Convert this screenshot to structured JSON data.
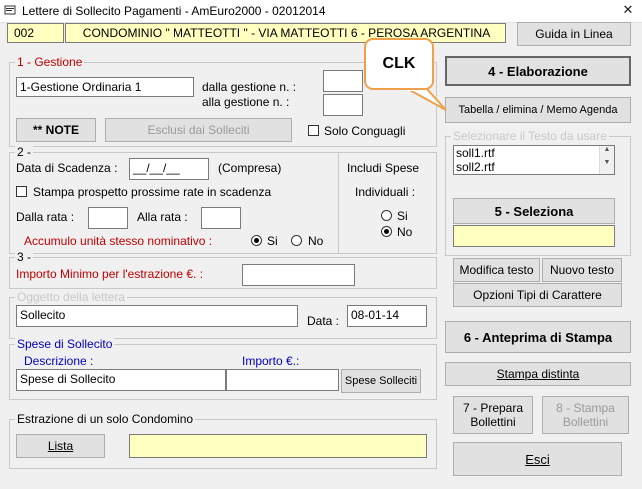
{
  "window": {
    "title": "Lettere di Sollecito Pagamenti - AmEuro2000 - 02012014",
    "close_glyph": "✕"
  },
  "header": {
    "code": "002",
    "condo_name": "CONDOMINIO \" MATTEOTTI \" - VIA MATTEOTTI 6 - PEROSA ARGENTINA",
    "help_button": "Guida in Linea"
  },
  "gestione": {
    "group_label": "1 - Gestione",
    "value": "1-Gestione Ordinaria 1",
    "dalla_label": "dalla gestione n. :",
    "alla_label": "alla gestione n. :",
    "dalla_value": "",
    "alla_value": "",
    "note_button": "** NOTE",
    "esclusi_button": "Esclusi dai Solleciti",
    "solo_conguagli_label": "Solo Conguagli"
  },
  "section2": {
    "group_label": "2 -",
    "data_scadenza_label": "Data di Scadenza :",
    "data_scadenza_value": "__/__/__",
    "compresa_label": "(Compresa)",
    "stampa_prospetto_label": "Stampa prospetto prossime rate in scadenza",
    "dalla_rata_label": "Dalla rata :",
    "alla_rata_label": "Alla rata :",
    "accumulo_label": "Accumulo unità stesso nominativo :",
    "si_label": "Si",
    "no_label": "No",
    "includi_label": "Includi Spese",
    "individuali_label": "Individuali :",
    "indiv_si": "Si",
    "indiv_no": "No"
  },
  "section3": {
    "group_label": "3 -",
    "importo_minimo_label": "Importo Minimo per l'estrazione €. :",
    "oggetto_label": "Oggetto della lettera",
    "oggetto_value": "Sollecito",
    "data_label": "Data :",
    "data_value": "08-01-14"
  },
  "spese": {
    "group_label": "Spese di Sollecito",
    "descrizione_label": "Descrizione :",
    "importo_label": "Importo €.:",
    "descrizione_value": "Spese di Sollecito",
    "importo_value": "",
    "spese_button": "Spese Solleciti"
  },
  "estrazione": {
    "group_label": "Estrazione di un solo Condomino",
    "lista_button": "Lista"
  },
  "right": {
    "elaborazione_button": "4 - Elaborazione",
    "elaborazione_u": "E",
    "tabella_button": "Tabella  / elimina / Memo Agenda",
    "seleziona_testo_label": "Selezionare il Testo da usare",
    "testi": [
      "soll1.rtf",
      "soll2.rtf"
    ],
    "seleziona_button": "5 - Seleziona",
    "modifica_button": "Modifica testo",
    "nuovo_button": "Nuovo testo",
    "opzioni_button": "Opzioni Tipi di Carattere",
    "anteprima_button": "6 - Anteprima di Stampa",
    "stampa_distinta_button": "Stampa distinta",
    "prepara_bollettini_line1": "7 - Prepara",
    "prepara_bollettini_line2": "Bollettini",
    "stampa_bollettini_line1": "8 - Stampa",
    "stampa_bollettini_line2": "Bollettini",
    "esci_button": "Esci"
  },
  "callout": {
    "text": "CLK"
  }
}
